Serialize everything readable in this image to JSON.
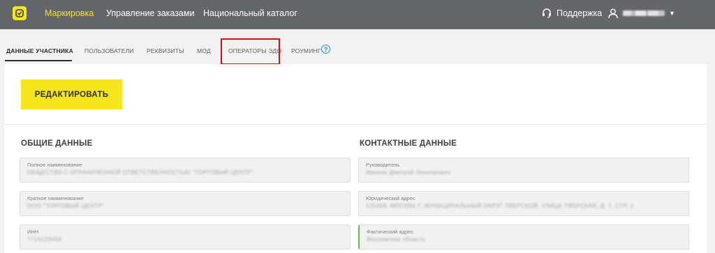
{
  "nav": {
    "items": [
      "Маркировка",
      "Управление заказами",
      "Национальный каталог"
    ],
    "support_label": "Поддержка",
    "user_name": "████████"
  },
  "tabs": [
    "ДАННЫЕ УЧАСТНИКА",
    "ПОЛЬЗОВАТЕЛИ",
    "РЕКВИЗИТЫ",
    "МОД",
    "ОПЕРАТОРЫ ЭДО",
    "РОУМИНГ"
  ],
  "card": {
    "edit_button": "РЕДАКТИРОВАТЬ",
    "general_title": "ОБЩИЕ ДАННЫЕ",
    "contact_title": "КОНТАКТНЫЕ ДАННЫЕ",
    "general_fields": [
      {
        "label": "Полное наименование",
        "value": "ОБЩЕСТВО С ОГРАНИЧЕННОЙ ОТВЕТСТВЕННОСТЬЮ \"ТОРГОВЫЙ ЦЕНТР\""
      },
      {
        "label": "Краткое наименование",
        "value": "ООО \"ТОРГОВЫЙ ЦЕНТР\""
      },
      {
        "label": "ИНН",
        "value": "7714123456"
      }
    ],
    "contact_fields": [
      {
        "label": "Руководитель",
        "value": "Иванов Дмитрий Николаевич"
      },
      {
        "label": "Юридический адрес",
        "value": "125009, МОСКВА Г, МУНИЦИПАЛЬНЫЙ ОКРУГ ТВЕРСКОЙ, УЛИЦА ТВЕРСКАЯ, Д. 7, СТР. 1"
      },
      {
        "label": "Фактический адрес",
        "value": "Московская область"
      }
    ]
  },
  "colors": {
    "accent": "#f6e51b",
    "topbar": "#63666a",
    "highlight": "#e30613",
    "help": "#1e88e5"
  }
}
